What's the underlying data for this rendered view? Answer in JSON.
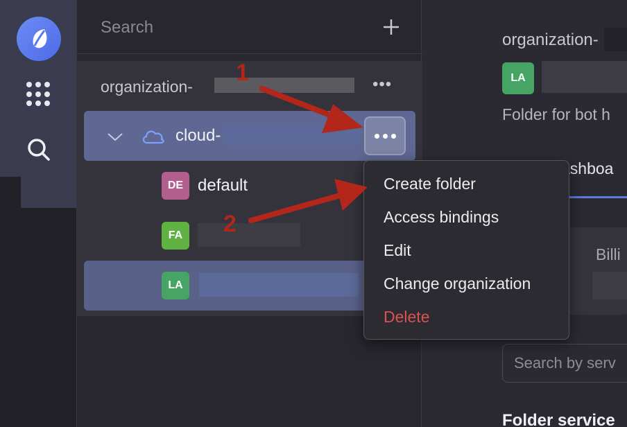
{
  "sidebar": {
    "logo_icon": "cloud-logo-icon",
    "apps_icon": "grid-icon",
    "search_icon": "search-icon"
  },
  "panel": {
    "search_label": "Search",
    "org_name": "organization-",
    "cloud_name": "cloud-",
    "folders": [
      {
        "badge": "DE",
        "label": "default",
        "color": "#b25e8f"
      },
      {
        "badge": "FA",
        "label": "",
        "color": "#5fb241"
      },
      {
        "badge": "LA",
        "label": "",
        "color": "#46a464"
      }
    ]
  },
  "menu": {
    "items": [
      "Create folder",
      "Access bindings",
      "Edit",
      "Change organization"
    ],
    "delete": "Delete"
  },
  "main": {
    "org_name": "organization-",
    "badge": "LA",
    "description": "Folder for bot h",
    "dashboard_tab": "ashboa",
    "billing": "Billi",
    "search_placeholder": "Search by serv",
    "section_title": "Folder service"
  },
  "annotations": {
    "step1": "1",
    "step2": "2",
    "color": "#b3261a"
  }
}
